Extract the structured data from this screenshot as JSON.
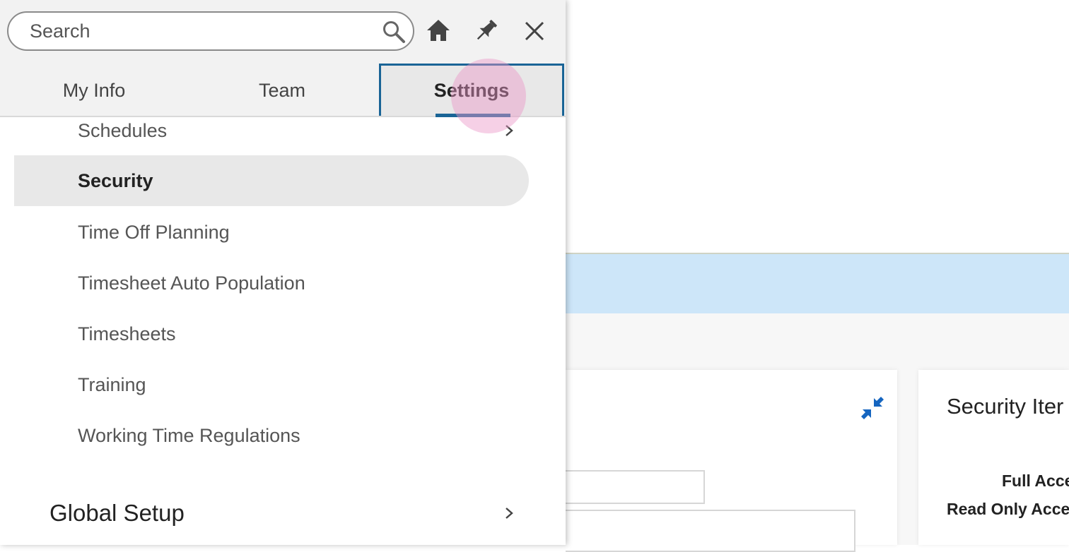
{
  "panel": {
    "search": {
      "placeholder": "Search",
      "value": ""
    },
    "header_icons": [
      "home-icon",
      "pin-icon",
      "close-icon"
    ],
    "tabs": [
      {
        "label": "My Info",
        "selected": false
      },
      {
        "label": "Team",
        "selected": false
      },
      {
        "label": "Settings",
        "selected": true
      }
    ],
    "items": [
      {
        "label": "Schedules",
        "has_chevron": true
      },
      {
        "label": "Security",
        "selected": true
      },
      {
        "label": "Time Off Planning"
      },
      {
        "label": "Timesheet Auto Population"
      },
      {
        "label": "Timesheets"
      },
      {
        "label": "Training"
      },
      {
        "label": "Working Time Regulations"
      }
    ],
    "section": {
      "label": "Global Setup",
      "has_chevron": true
    }
  },
  "background": {
    "card_right": {
      "title": "Security Iter",
      "rows": [
        "Full Acce",
        "Read Only Acce"
      ]
    },
    "collapse_icon": "collapse-arrows-icon"
  },
  "colors": {
    "accent": "#1a6496",
    "banner": "#cde6f9",
    "icon_blue": "#1565c0",
    "selected_bg": "#e8e8e8"
  }
}
